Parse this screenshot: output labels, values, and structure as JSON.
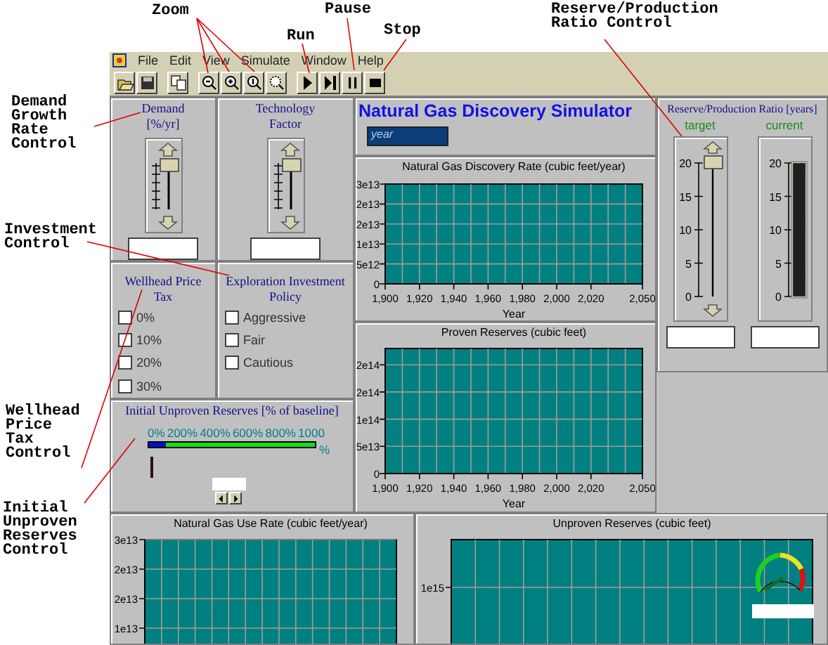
{
  "annotations": [
    {
      "text": "Zoom"
    },
    {
      "text": "Run"
    },
    {
      "text": "Pause"
    },
    {
      "text": "Stop"
    },
    {
      "text": "Reserve/Production Ratio Control"
    },
    {
      "text": "Demand Growth Rate Control"
    },
    {
      "text": "Investment Control"
    },
    {
      "text": "Wellhead Price Tax Control"
    },
    {
      "text": "Initial Unproven Reserves Control"
    }
  ],
  "menu": [
    {
      "label": "File"
    },
    {
      "label": "Edit"
    },
    {
      "label": "View"
    },
    {
      "label": "Simulate"
    },
    {
      "label": "Window"
    },
    {
      "label": "Help"
    }
  ],
  "demand_control": {
    "title": "Demand [%/yr]",
    "level": 1
  },
  "technology_control": {
    "title": "Technology Factor",
    "level": 1
  },
  "wellhead_tax": {
    "title": "Wellhead Price Tax",
    "options": [
      {
        "label": "0%",
        "checked": false
      },
      {
        "label": "10%",
        "checked": false
      },
      {
        "label": "20%",
        "checked": false
      },
      {
        "label": "30%",
        "checked": false
      }
    ]
  },
  "exploration_policy": {
    "title": "Exploration Investment Policy",
    "options": [
      {
        "label": "Aggressive",
        "checked": false
      },
      {
        "label": "Fair",
        "checked": false
      },
      {
        "label": "Cautious",
        "checked": false
      }
    ]
  },
  "initial_reserves": {
    "title": "Initial Unproven Reserves [% of baseline]",
    "scale": [
      "0%",
      "200%",
      "400%",
      "600%",
      "800%",
      "1000"
    ],
    "unit": "%",
    "level": 0.1
  },
  "simulator": {
    "title": "Natural Gas Discovery Simulator",
    "year_display": "year"
  },
  "discovery_chart": {
    "chart_data": {
      "type": "line",
      "grid": true,
      "title": "Natural Gas Discovery Rate (cubic feet/year)",
      "xlabel": "Year",
      "xlim": [
        1900,
        2050
      ],
      "ylim": [
        0,
        25000000000000.0
      ],
      "xticks": [
        {
          "value": 1900,
          "label": "1,900"
        },
        {
          "value": 1920,
          "label": "1,920"
        },
        {
          "value": 1940,
          "label": "1,940"
        },
        {
          "value": 1960,
          "label": "1,960"
        },
        {
          "value": 1980,
          "label": "1,980"
        },
        {
          "value": 2000,
          "label": "2,000"
        },
        {
          "value": 2020,
          "label": "2,020"
        },
        {
          "value": 2050,
          "label": "2,050"
        }
      ],
      "yticks": [
        {
          "value": 0,
          "label": "0"
        },
        {
          "value": 5000000000000.0,
          "label": "5e12"
        },
        {
          "value": 10000000000000.0,
          "label": "1e13"
        },
        {
          "value": 15000000000000.0,
          "label": "2e13"
        },
        {
          "value": 20000000000000.0,
          "label": "2e13"
        },
        {
          "value": 25000000000000.0,
          "label": "3e13"
        }
      ]
    }
  },
  "reserves_chart": {
    "chart_data": {
      "type": "line",
      "grid": true,
      "title": "Proven Reserves (cubic feet)",
      "xlabel": "Year",
      "xlim": [
        1900,
        2050
      ],
      "ylim": [
        0,
        230000000000000.0
      ],
      "xticks": [
        {
          "value": 1900,
          "label": "1,900"
        },
        {
          "value": 1920,
          "label": "1,920"
        },
        {
          "value": 1940,
          "label": "1,940"
        },
        {
          "value": 1960,
          "label": "1,960"
        },
        {
          "value": 1980,
          "label": "1,980"
        },
        {
          "value": 2000,
          "label": "2,000"
        },
        {
          "value": 2020,
          "label": "2,020"
        },
        {
          "value": 2050,
          "label": "2,050"
        }
      ],
      "yticks": [
        {
          "value": 0,
          "label": "0"
        },
        {
          "value": 50000000000000.0,
          "label": "5e13"
        },
        {
          "value": 100000000000000.0,
          "label": "1e14"
        },
        {
          "value": 150000000000000.0,
          "label": "2e14"
        },
        {
          "value": 200000000000000.0,
          "label": "2e14"
        }
      ]
    }
  },
  "rp_ratio": {
    "title": "Reserve/Production Ratio [years]",
    "target": {
      "label": "target",
      "ticks": [
        "20",
        "15",
        "10",
        "5",
        "0"
      ],
      "level": 1
    },
    "current": {
      "label": "current",
      "ticks": [
        "20",
        "15",
        "10",
        "5",
        "0"
      ],
      "level": 1
    }
  },
  "use_rate_chart": {
    "title": "Natural Gas Use Rate (cubic feet/year)",
    "y_labels": [
      "3e13",
      "2e13",
      "2e13",
      "1e13"
    ]
  },
  "unproven_chart": {
    "title": "Unproven Reserves (cubic feet)",
    "y_labels": [
      "1e15"
    ]
  }
}
